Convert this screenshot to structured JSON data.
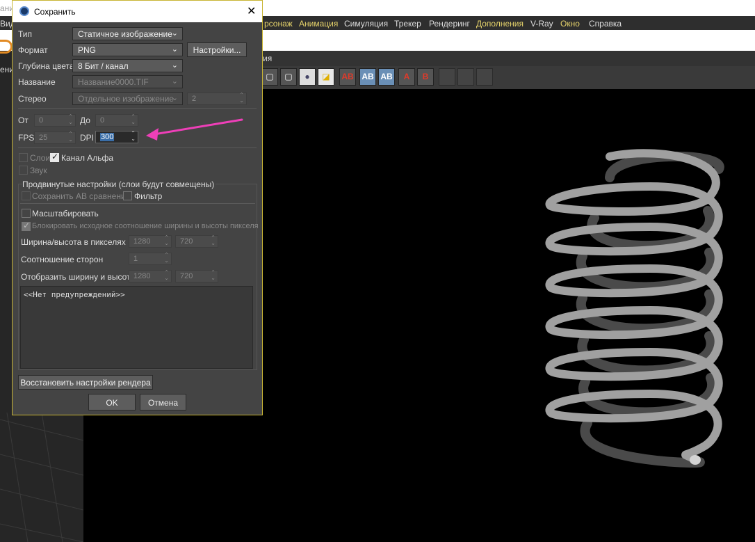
{
  "app": {
    "top_strip_text": "ани",
    "menu": [
      "Вид",
      "рсонаж",
      "Анимация",
      "Симуляция",
      "Трекер",
      "Рендеринг",
      "Дополнения",
      "V-Ray",
      "Окно",
      "Справка"
    ],
    "left_panel_text": "ени",
    "panel_title": "ия"
  },
  "toolbar": {
    "buttons": [
      "region-render",
      "render-view",
      "render-settings",
      "stereo-mode",
      "ab-compare-a",
      "ab-compare-b",
      "ab-compare-ab",
      "swap-a",
      "swap-b",
      "tool-1",
      "tool-2",
      "tool-3"
    ],
    "letters": {
      "a": "A",
      "b": "B",
      "ab": "AB"
    }
  },
  "dialog": {
    "title": "Сохранить",
    "close": "✕",
    "type_label": "Тип",
    "type_value": "Статичное изображение",
    "format_label": "Формат",
    "format_value": "PNG",
    "settings_button": "Настройки...",
    "depth_label": "Глубина цвета",
    "depth_value": "8 Бит / канал",
    "name_label": "Название",
    "name_value": "Название0000.TIF",
    "stereo_label": "Стерео",
    "stereo_value": "Отдельное изображение",
    "stereo_count": "2",
    "from_label": "От",
    "from_value": "0",
    "to_label": "До",
    "to_value": "0",
    "fps_label": "FPS",
    "fps_value": "25",
    "dpi_label": "DPI",
    "dpi_value": "300",
    "layers_label": "Слои",
    "alpha_label": "Канал Альфа",
    "sound_label": "Звук",
    "advanced_label": "Продвинутые настройки (слои будут совмещены)",
    "ab_compare_label": "Сохранить AB сравнение",
    "filter_label": "Фильтр",
    "scale_label": "Масштабировать",
    "lock_ratio_label": "Блокировать исходное соотношение ширины и высоты пикселя",
    "pixel_wh_label": "Ширина/высота в пикселях",
    "pixel_w": "1280",
    "pixel_h": "720",
    "aspect_label": "Соотношение сторон",
    "aspect_value": "1",
    "display_wh_label": "Отобразить ширину и высоту",
    "display_w": "1280",
    "display_h": "720",
    "warnings": "<<Нет предупреждений>>",
    "restore_button": "Восстановить настройки рендера",
    "ok_button": "OK",
    "cancel_button": "Отмена"
  },
  "colors": {
    "dialog_bg": "#444444",
    "dialog_border": "#c8b534",
    "menu_highlight": "#e6d36b",
    "annotation_arrow": "#ee3fb8",
    "spring": "#9a9a9a"
  }
}
